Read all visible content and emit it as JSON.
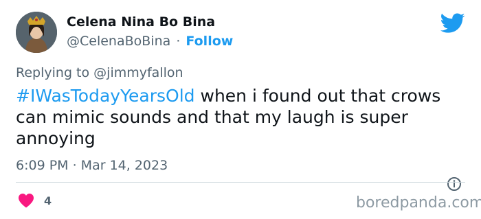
{
  "author": {
    "name": "Celena Nina Bo Bina",
    "handle": "@CelenaBoBina",
    "separator": "·",
    "follow_label": "Follow"
  },
  "reply": {
    "prefix": "Replying to",
    "mention": "@jimmyfallon"
  },
  "tweet": {
    "hashtag": "#IWasTodayYearsOld",
    "body": " when i found out that crows can mimic sounds and that my laugh is super annoying"
  },
  "meta": {
    "timestamp": "6:09 PM · Mar 14, 2023"
  },
  "engagement": {
    "likes": "4"
  },
  "watermark": "boredpanda.com",
  "icons": {
    "brand": "twitter-bird-icon",
    "info": "info-icon",
    "like": "heart-icon"
  },
  "colors": {
    "accent": "#1d9bf0",
    "like": "#f91880",
    "muted": "#536471",
    "text": "#0f1419"
  }
}
